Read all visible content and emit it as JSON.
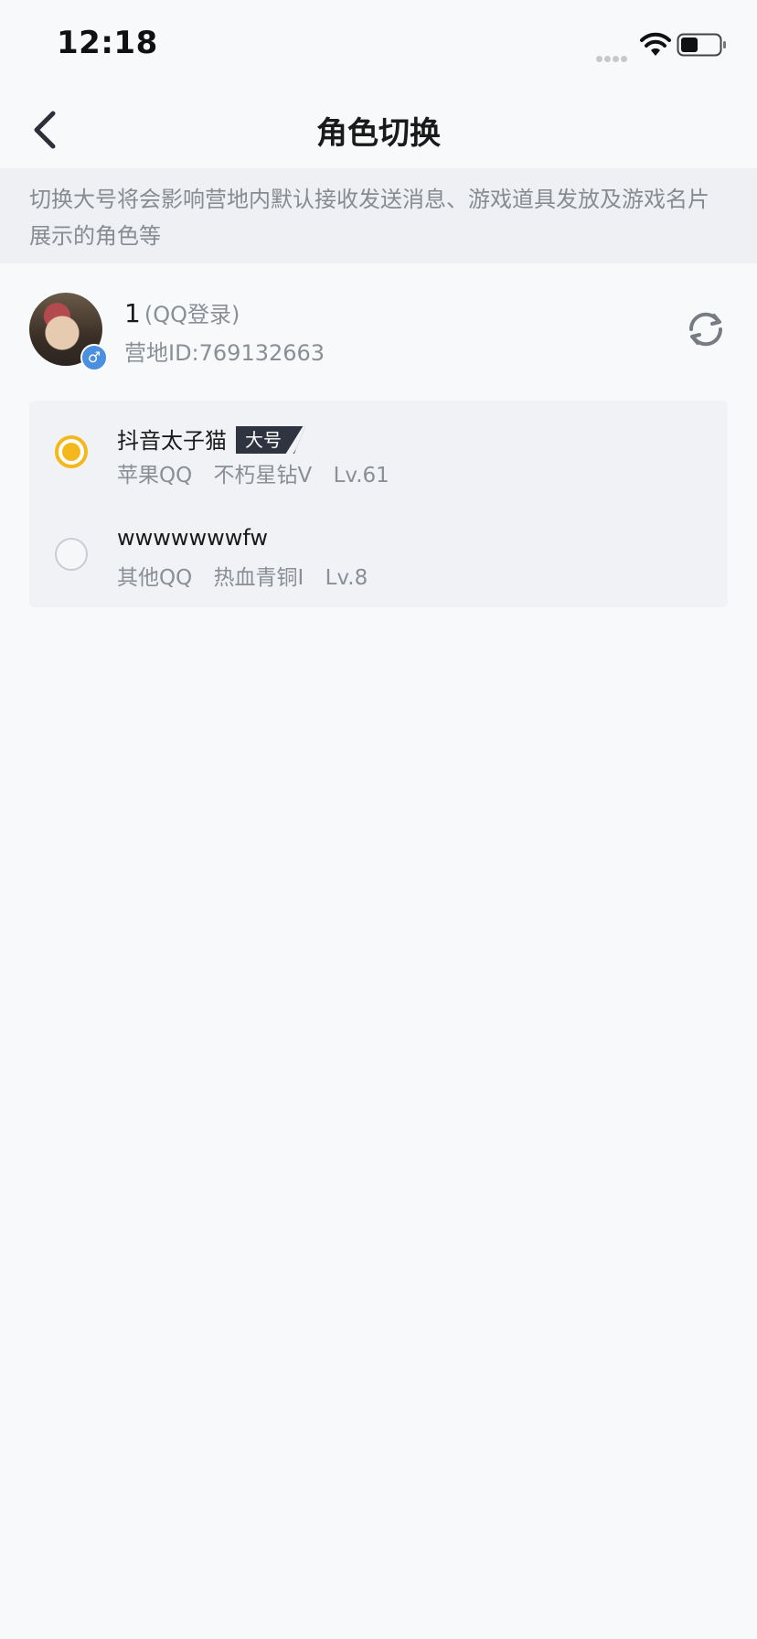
{
  "status_bar": {
    "time": "12:18"
  },
  "nav": {
    "title": "角色切换"
  },
  "notice": {
    "text": "切换大号将会影响营地内默认接收发送消息、游戏道具发放及游戏名片展示的角色等"
  },
  "account": {
    "name": "1",
    "login_type": "(QQ登录)",
    "camp_id": "营地ID:769132663",
    "gender_symbol": "♂"
  },
  "roles": [
    {
      "name": "抖音太子猫",
      "badge": "大号",
      "platform": "苹果QQ",
      "rank": "不朽星钻V",
      "level": "Lv.61",
      "selected": true
    },
    {
      "name": "wwwwwwwfw",
      "badge": "",
      "platform": "其他QQ",
      "rank": "热血青铜I",
      "level": "Lv.8",
      "selected": false
    }
  ],
  "colors": {
    "accent": "#f5b81c",
    "gender": "#4a8fe0",
    "badge_bg": "#2e3440"
  },
  "icons": {
    "back": "chevron-left-icon",
    "refresh": "refresh-icon",
    "wifi": "wifi-icon",
    "battery": "battery-icon",
    "signal": "signal-icon"
  }
}
